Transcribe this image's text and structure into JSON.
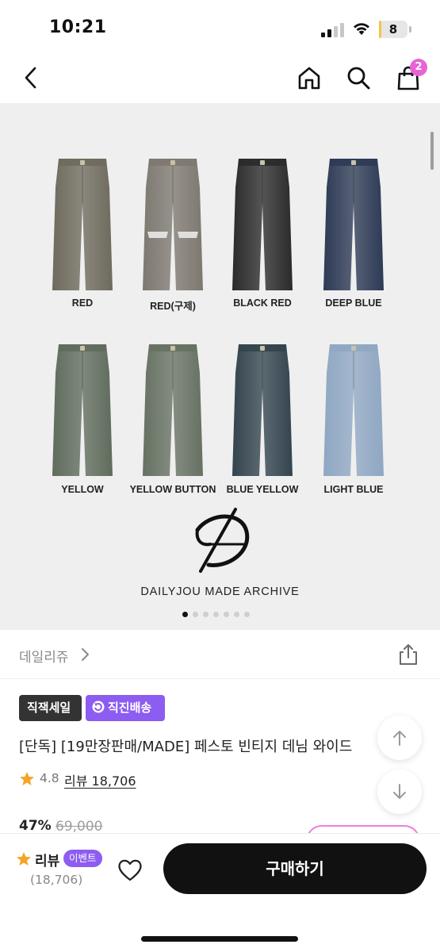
{
  "status_bar": {
    "time": "10:21",
    "battery": "8",
    "battery_level": 0.08
  },
  "nav": {
    "cart_count": "2"
  },
  "gallery": {
    "variants": [
      {
        "label": "RED",
        "color": "#6e6a5d",
        "ripped": false
      },
      {
        "label": "RED(구제)",
        "color": "#7d7870",
        "ripped": true
      },
      {
        "label": "BLACK RED",
        "color": "#2a2a2a",
        "ripped": false
      },
      {
        "label": "DEEP BLUE",
        "color": "#2d3a55",
        "ripped": false
      },
      {
        "label": "YELLOW",
        "color": "#5f6c5c",
        "ripped": false
      },
      {
        "label": "YELLOW BUTTON",
        "color": "#667162",
        "ripped": false
      },
      {
        "label": "BLUE YELLOW",
        "color": "#33444e",
        "ripped": false
      },
      {
        "label": "LIGHT BLUE",
        "color": "#8fa7c3",
        "ripped": false
      }
    ],
    "brand_caption": "DAILYJOU MADE ARCHIVE",
    "slide_count": 7,
    "active_slide": 0
  },
  "product": {
    "brand": "데일리쥬",
    "tags": {
      "sale": "직잭세일",
      "shipping": "직진배송"
    },
    "title": "[단독] [19만장판매/MADE] 페스토 빈티지 데님 와이드",
    "rating": "4.8",
    "review_link": "리뷰 18,706",
    "discount": "47%",
    "old_price": "69,000"
  },
  "bottom_bar": {
    "review_label": "리뷰",
    "event_badge": "이벤트",
    "review_count": "(18,706)",
    "buy_label": "구매하기"
  },
  "colors": {
    "accent_purple": "#8d5cf1",
    "cart_badge": "#e764d6",
    "star": "#f4a426"
  }
}
